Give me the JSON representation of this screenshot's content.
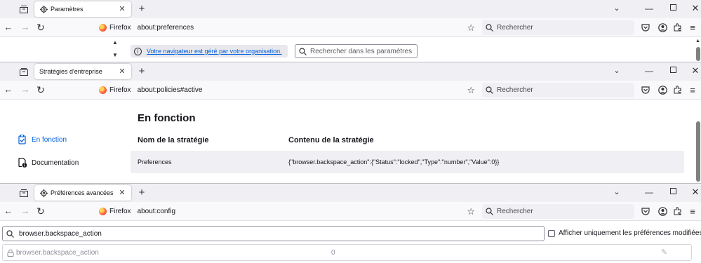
{
  "windows": [
    {
      "tab_title": "Paramètres",
      "browser_label": "Firefox",
      "url": "about:preferences",
      "search_placeholder": "Rechercher",
      "managed_notice": "Votre navigateur est géré par votre organisation.",
      "prefs_search_placeholder": "Rechercher dans les paramètres"
    },
    {
      "tab_title": "Stratégies d'entreprise",
      "browser_label": "Firefox",
      "url": "about:policies#active",
      "search_placeholder": "Rechercher",
      "page_heading": "En fonction",
      "sidebar": [
        {
          "label": "En fonction",
          "active": true
        },
        {
          "label": "Documentation",
          "active": false
        }
      ],
      "table": {
        "headers": [
          "Nom de la stratégie",
          "Contenu de la stratégie"
        ],
        "rows": [
          {
            "name": "Preferences",
            "content": "{\"browser.backspace_action\":{\"Status\":\"locked\",\"Type\":\"number\",\"Value\":0}}"
          }
        ]
      }
    },
    {
      "tab_title": "Préférences avancées",
      "browser_label": "Firefox",
      "url": "about:config",
      "search_placeholder": "Rechercher",
      "config_search_value": "browser.backspace_action",
      "show_modified_label": "Afficher uniquement les préférences modifiées",
      "pref_row": {
        "name": "browser.backspace_action",
        "value": "0"
      }
    }
  ]
}
